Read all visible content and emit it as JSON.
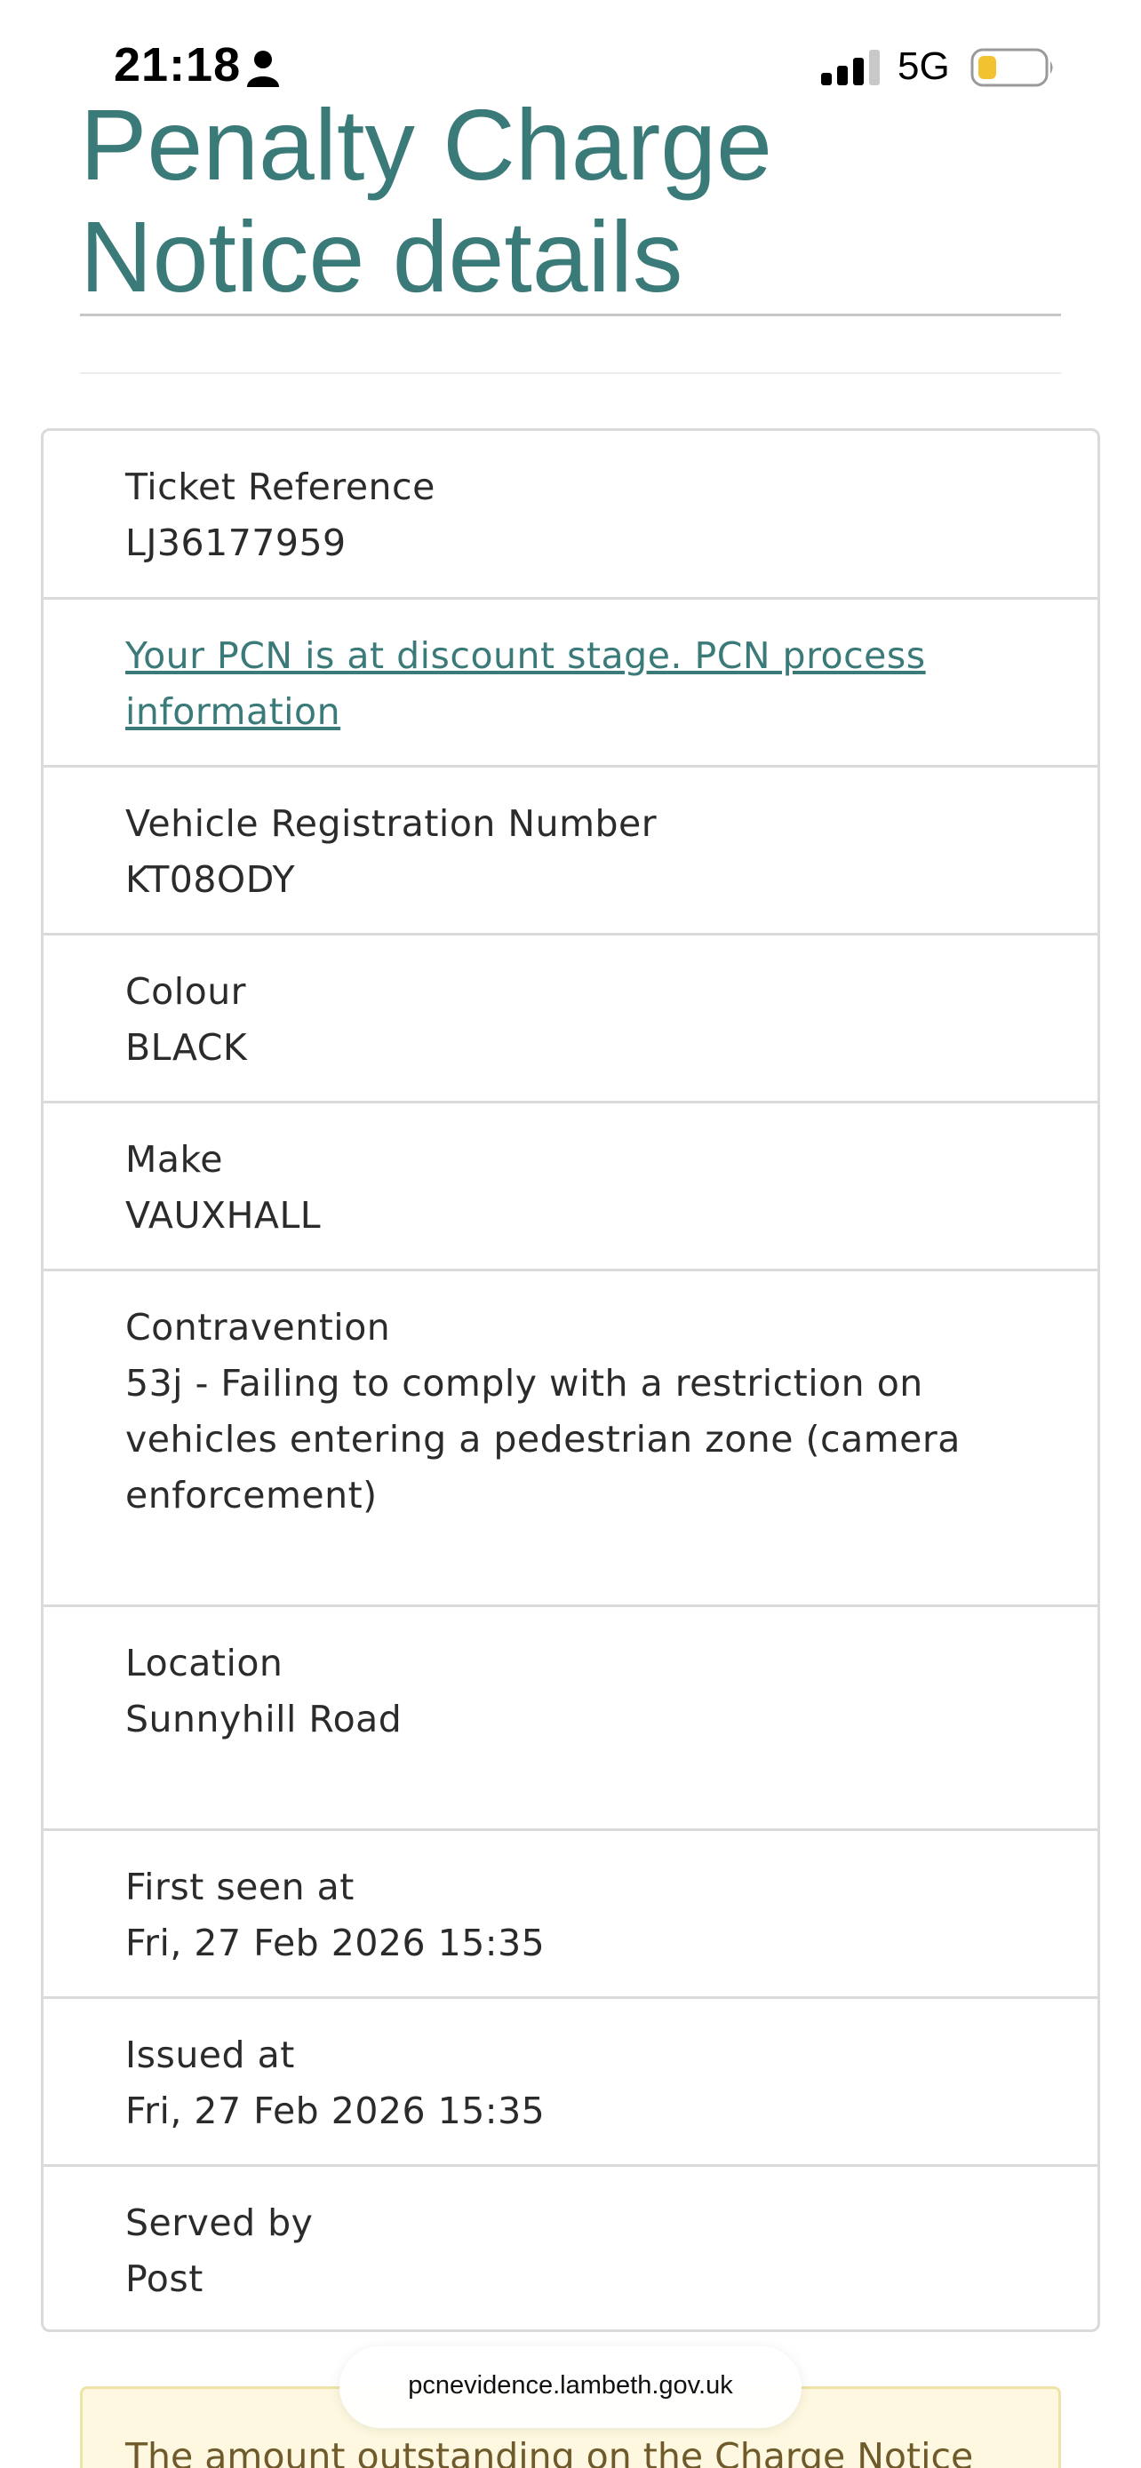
{
  "status_bar": {
    "time": "21:18",
    "network": "5G",
    "icons": [
      "person-icon",
      "signal-icon",
      "battery-icon"
    ],
    "battery_color": "#f2c230"
  },
  "page": {
    "title": "Penalty Charge Notice details",
    "accent_color": "#3a7a78"
  },
  "details": {
    "ticket_reference": {
      "label": "Ticket Reference",
      "value": "LJ36177959"
    },
    "discount_link": "Your PCN is at discount stage. PCN process information",
    "vrn": {
      "label": "Vehicle Registration Number",
      "value": "KT08ODY"
    },
    "colour": {
      "label": "Colour",
      "value": "BLACK"
    },
    "make": {
      "label": "Make",
      "value": "VAUXHALL"
    },
    "contravention": {
      "label": "Contravention",
      "value": "53j - Failing to comply with a restriction on vehicles entering a pedestrian zone (camera enforcement)"
    },
    "location": {
      "label": "Location",
      "value": "Sunnyhill Road"
    },
    "first_seen": {
      "label": "First seen at",
      "value": "Fri, 27 Feb 2026 15:35"
    },
    "issued": {
      "label": "Issued at",
      "value": "Fri, 27 Feb 2026 15:35"
    },
    "served_by": {
      "label": "Served by",
      "value": "Post"
    }
  },
  "notice": {
    "text": "The amount outstanding on the Charge Notice"
  },
  "browser": {
    "url": "pcnevidence.lambeth.gov.uk"
  }
}
